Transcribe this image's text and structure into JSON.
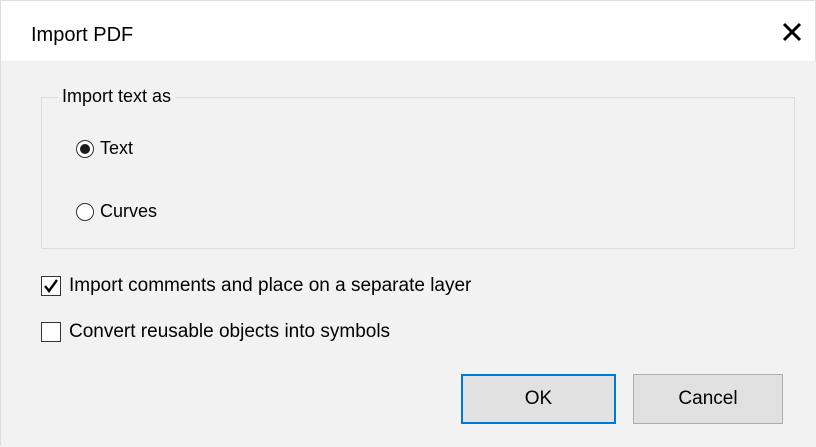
{
  "dialog": {
    "title": "Import PDF",
    "close_icon": "close-icon"
  },
  "import_text_group": {
    "legend": "Import text as",
    "options": [
      {
        "label": "Text",
        "selected": true
      },
      {
        "label": "Curves",
        "selected": false
      }
    ]
  },
  "checkboxes": [
    {
      "label": "Import comments and place on a separate layer",
      "checked": true
    },
    {
      "label": "Convert reusable objects into symbols",
      "checked": false
    }
  ],
  "buttons": {
    "ok_label": "OK",
    "cancel_label": "Cancel"
  },
  "colors": {
    "body_background": "#f2f2f2",
    "default_button_border": "#0078d7"
  }
}
